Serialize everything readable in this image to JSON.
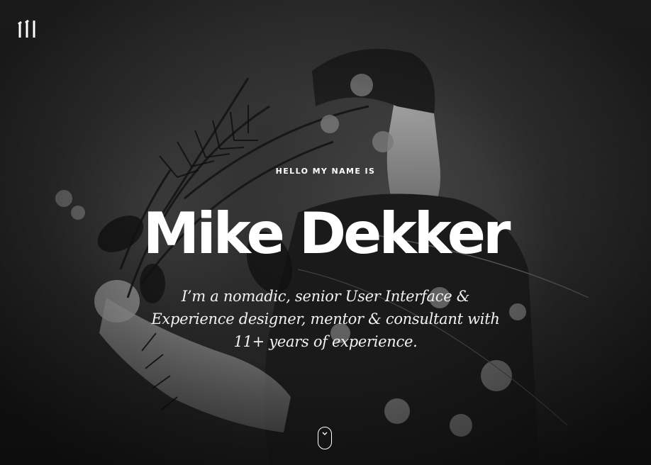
{
  "header": {
    "logo_icon": "mike-dekker-monogram-icon"
  },
  "hero": {
    "intro": "HELLO MY NAME IS",
    "name": "Mike Dekker",
    "tagline_lines": [
      "I’m a nomadic, senior User Interface &",
      "Experience designer, mentor & consultant with",
      "11+ years of experience."
    ],
    "scroll_icon": "mouse-scroll-icon"
  },
  "colors": {
    "text": "#ffffff",
    "background": "#2b2b2b"
  }
}
